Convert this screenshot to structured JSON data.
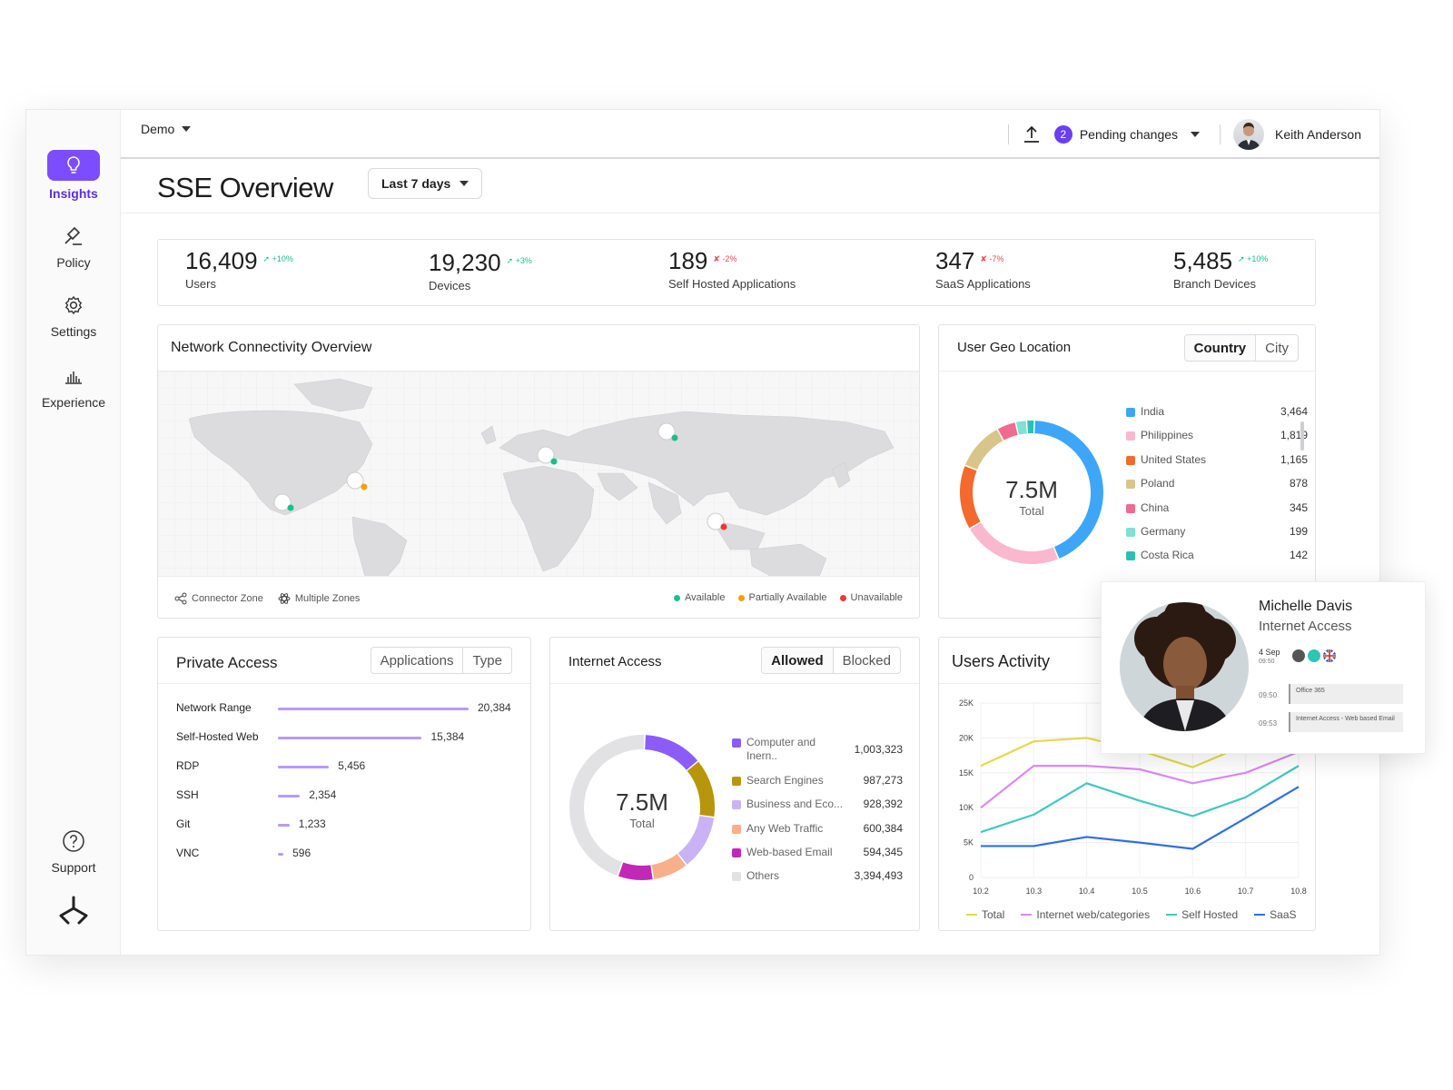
{
  "sidebar": {
    "items": [
      {
        "label": "Insights",
        "icon": "lightbulb-icon"
      },
      {
        "label": "Policy",
        "icon": "gavel-icon"
      },
      {
        "label": "Settings",
        "icon": "gear-icon"
      },
      {
        "label": "Experience",
        "icon": "bar-chart-icon"
      }
    ],
    "support_label": "Support",
    "logo": "brand-logo-icon"
  },
  "topbar": {
    "project": "Demo",
    "pending_count": "2",
    "pending_label": "Pending changes",
    "user_name": "Keith Anderson"
  },
  "header": {
    "title": "SSE Overview",
    "period": "Last 7 days"
  },
  "stats": [
    {
      "value": "16,409",
      "delta": "+10%",
      "trend": "up",
      "label": "Users"
    },
    {
      "value": "19,230",
      "delta": "+3%",
      "trend": "up",
      "label": "Devices"
    },
    {
      "value": "189",
      "delta": "-2%",
      "trend": "down",
      "label": "Self Hosted Applications"
    },
    {
      "value": "347",
      "delta": "-7%",
      "trend": "down",
      "label": "SaaS Applications"
    },
    {
      "value": "5,485",
      "delta": "+10%",
      "trend": "up",
      "label": "Branch Devices"
    }
  ],
  "network": {
    "title": "Network Connectivity Overview",
    "legend_connector": "Connector Zone",
    "legend_multi": "Multiple Zones",
    "status": [
      {
        "label": "Available",
        "color": "#1bbf8a"
      },
      {
        "label": "Partially Available",
        "color": "#f4a000"
      },
      {
        "label": "Unavailable",
        "color": "#e83a3a"
      }
    ]
  },
  "geo": {
    "title": "User Geo Location",
    "tab_country": "Country",
    "tab_city": "City",
    "total_value": "7.5M",
    "total_label": "Total",
    "rows": [
      {
        "name": "India",
        "value": "3,464",
        "color": "#3ea6f7"
      },
      {
        "name": "Philippines",
        "value": "1,819",
        "color": "#f9b8cd"
      },
      {
        "name": "United States",
        "value": "1,165",
        "color": "#f46a2c"
      },
      {
        "name": "Poland",
        "value": "878",
        "color": "#d9c48a"
      },
      {
        "name": "China",
        "value": "345",
        "color": "#f06a91"
      },
      {
        "name": "Germany",
        "value": "199",
        "color": "#7fe0d4"
      },
      {
        "name": "Costa Rica",
        "value": "142",
        "color": "#28c2b2"
      }
    ]
  },
  "private_access": {
    "title": "Private Access",
    "tab_applications": "Applications",
    "tab_type": "Type",
    "rows": [
      {
        "name": "Network Range",
        "value": "20,384",
        "num": 20384
      },
      {
        "name": "Self-Hosted Web",
        "value": "15,384",
        "num": 15384
      },
      {
        "name": "RDP",
        "value": "5,456",
        "num": 5456
      },
      {
        "name": "SSH",
        "value": "2,354",
        "num": 2354
      },
      {
        "name": "Git",
        "value": "1,233",
        "num": 1233
      },
      {
        "name": "VNC",
        "value": "596",
        "num": 596
      }
    ]
  },
  "internet_access": {
    "title": "Internet Access",
    "tab_allowed": "Allowed",
    "tab_blocked": "Blocked",
    "total_value": "7.5M",
    "total_label": "Total",
    "rows": [
      {
        "name": "Computer and Inern..",
        "value": "1,003,323",
        "color": "#8b5cf6"
      },
      {
        "name": "Search Engines",
        "value": "987,273",
        "color": "#b8960c"
      },
      {
        "name": "Business and Eco...",
        "value": "928,392",
        "color": "#c9b3f6"
      },
      {
        "name": "Any Web Traffic",
        "value": "600,384",
        "color": "#f7b08a"
      },
      {
        "name": "Web-based Email",
        "value": "594,345",
        "color": "#c228b8"
      },
      {
        "name": "Others",
        "value": "3,394,493",
        "color": "#e2e2e4"
      }
    ]
  },
  "users_activity": {
    "title": "Users Activity"
  },
  "chart_data": {
    "type": "line",
    "x": [
      "10.2",
      "10.3",
      "10.4",
      "10.5",
      "10.6",
      "10.7",
      "10.8"
    ],
    "y_ticks": [
      "0",
      "5K",
      "10K",
      "15K",
      "20K",
      "25K"
    ],
    "ylim": [
      0,
      25000
    ],
    "series": [
      {
        "name": "Total",
        "color": "#e4d94a",
        "values": [
          16000,
          19500,
          20000,
          18200,
          15800,
          19000,
          20500
        ]
      },
      {
        "name": "Internet web/categories",
        "color": "#d98af0",
        "values": [
          10000,
          16000,
          16000,
          15500,
          13500,
          15000,
          18000
        ]
      },
      {
        "name": "Self Hosted",
        "color": "#3fc9bf",
        "values": [
          6500,
          9000,
          13500,
          11000,
          8800,
          11500,
          16000
        ]
      },
      {
        "name": "SaaS",
        "color": "#2f6fe0",
        "values": [
          4500,
          4500,
          5800,
          5000,
          4100,
          8500,
          13000
        ]
      }
    ]
  },
  "profile_popup": {
    "name": "Michelle Davis",
    "role": "Internet Access",
    "date": "4 Sep",
    "time": "09:50",
    "events": [
      {
        "time": "09:50",
        "label": "Office 365"
      },
      {
        "time": "09:53",
        "label": "Internet Access - Web based Email"
      }
    ]
  }
}
